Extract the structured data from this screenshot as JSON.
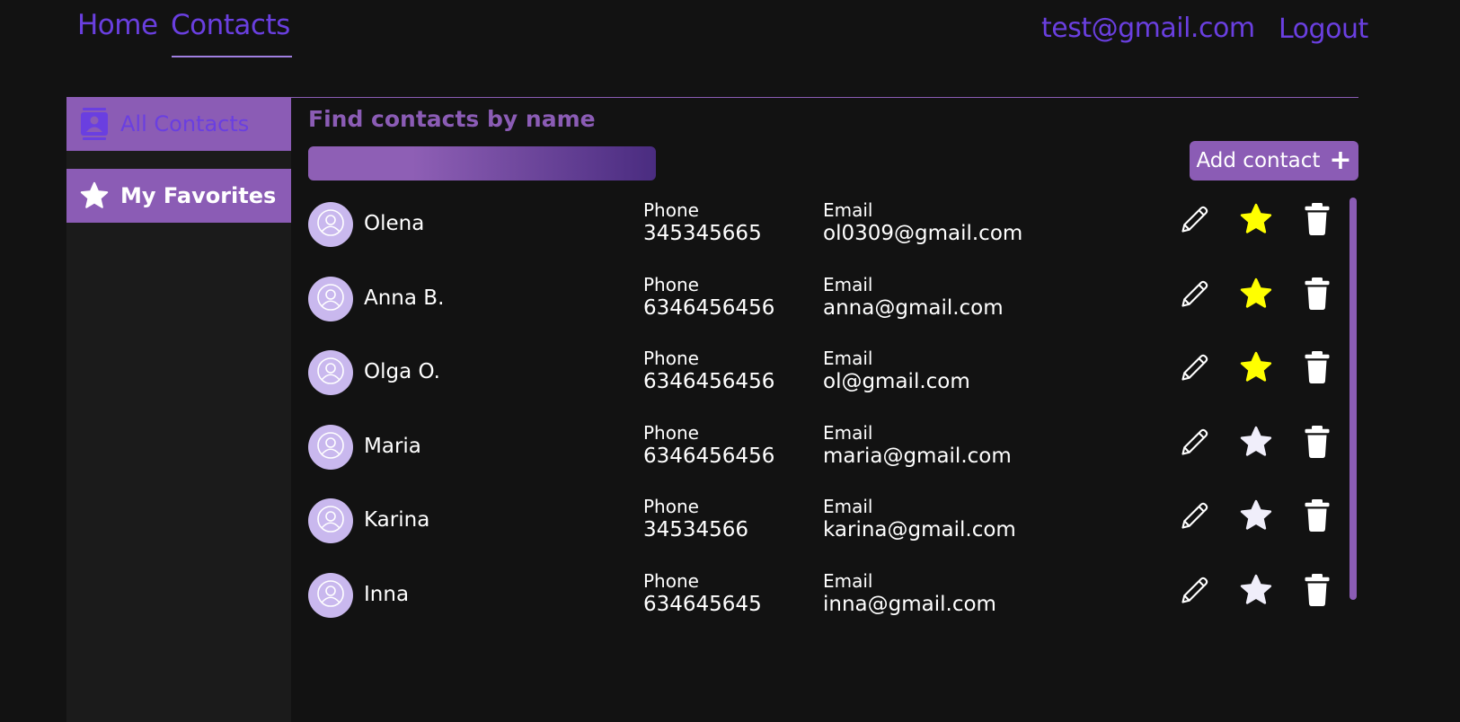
{
  "header": {
    "nav": [
      {
        "label": "Home"
      },
      {
        "label": "Contacts"
      }
    ],
    "user_email": "test@gmail.com",
    "logout_label": "Logout"
  },
  "sidebar": {
    "items": [
      {
        "label": "All Contacts",
        "icon": "contacts-book-icon"
      },
      {
        "label": "My Favorites",
        "icon": "star-icon"
      }
    ]
  },
  "search": {
    "label": "Find contacts by name",
    "value": "",
    "placeholder": ""
  },
  "toolbar": {
    "add_label": "Add contact",
    "add_icon": "plus-icon"
  },
  "colors": {
    "accent": "#8b5cb5",
    "link": "#6a3fe0",
    "favorite": "#ffff00",
    "background": "#121212"
  },
  "contacts": [
    {
      "name": "Olena",
      "phone_label": "Phone",
      "phone": "345345665",
      "email_label": "Email",
      "email": "ol0309@gmail.com",
      "favorite": true
    },
    {
      "name": "Anna B.",
      "phone_label": "Phone",
      "phone": "6346456456",
      "email_label": "Email",
      "email": "anna@gmail.com",
      "favorite": true
    },
    {
      "name": "Olga O.",
      "phone_label": "Phone",
      "phone": "6346456456",
      "email_label": "Email",
      "email": "ol@gmail.com",
      "favorite": true
    },
    {
      "name": "Maria",
      "phone_label": "Phone",
      "phone": "6346456456",
      "email_label": "Email",
      "email": "maria@gmail.com",
      "favorite": false
    },
    {
      "name": "Karina",
      "phone_label": "Phone",
      "phone": "34534566",
      "email_label": "Email",
      "email": "karina@gmail.com",
      "favorite": false
    },
    {
      "name": "Inna",
      "phone_label": "Phone",
      "phone": "634645645",
      "email_label": "Email",
      "email": "inna@gmail.com",
      "favorite": false
    }
  ]
}
